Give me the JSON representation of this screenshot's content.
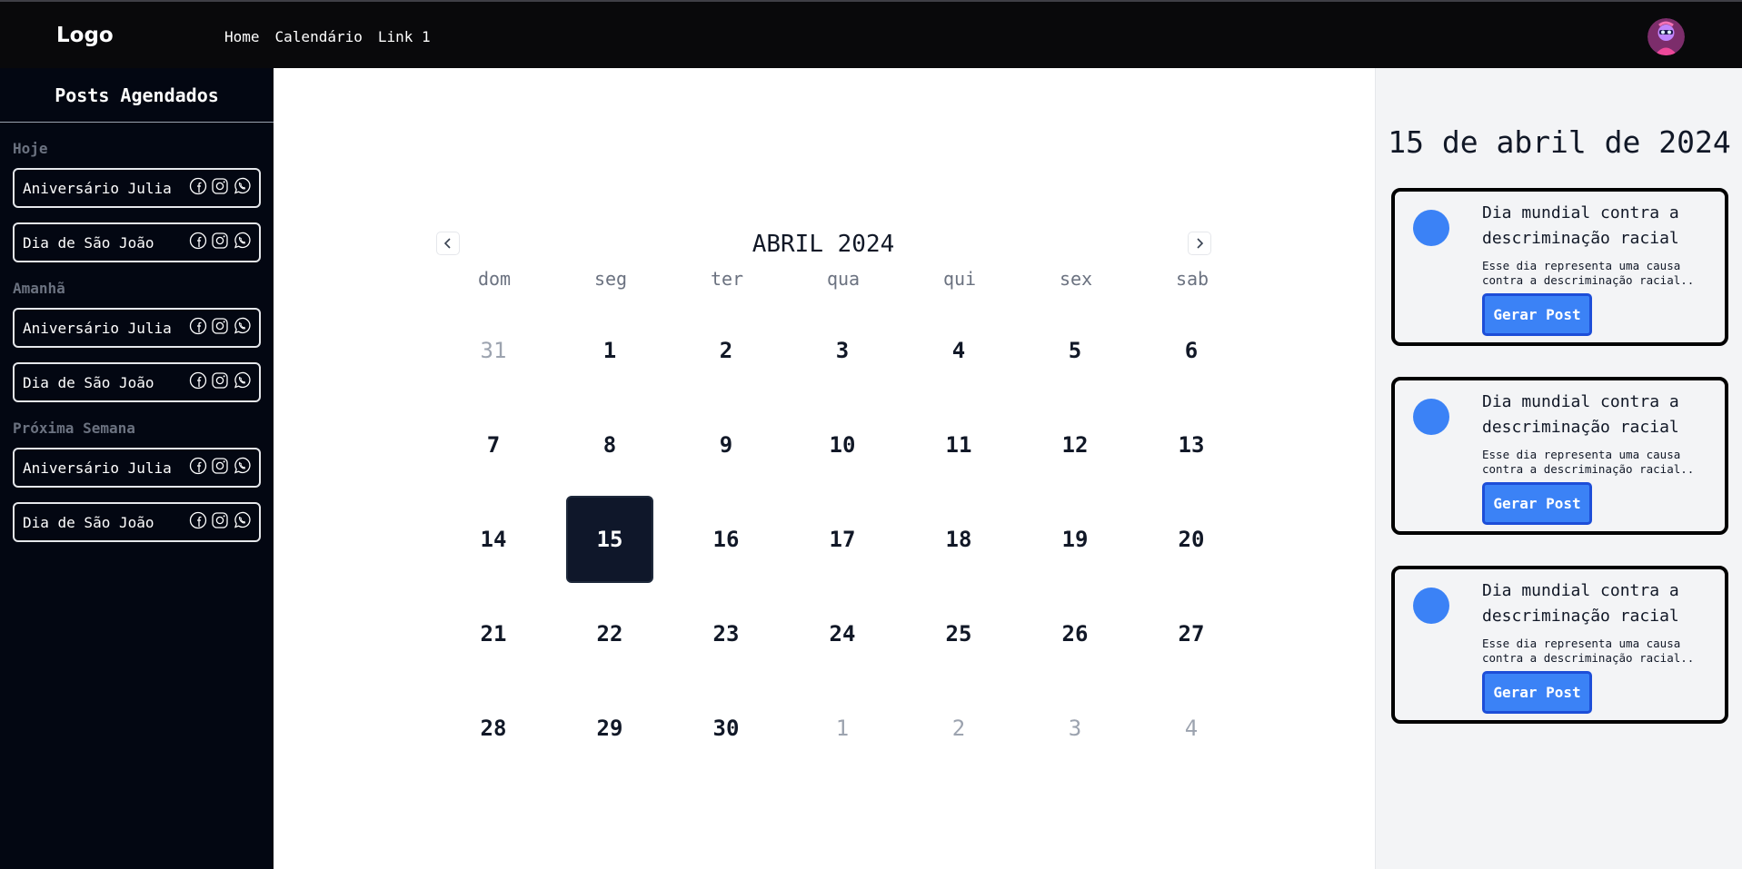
{
  "nav": {
    "logo": "Logo",
    "links": [
      "Home",
      "Calendário",
      "Link 1"
    ]
  },
  "sidebar": {
    "title": "Posts Agendados",
    "groups": [
      {
        "label": "Hoje",
        "items": [
          {
            "label": "Aniversário Julia",
            "icons": [
              "facebook-icon",
              "instagram-icon",
              "whatsapp-icon"
            ]
          },
          {
            "label": "Dia de São João",
            "icons": [
              "facebook-icon",
              "instagram-icon",
              "whatsapp-icon"
            ]
          }
        ]
      },
      {
        "label": "Amanhã",
        "items": [
          {
            "label": "Aniversário Julia",
            "icons": [
              "facebook-icon",
              "instagram-icon",
              "whatsapp-icon"
            ]
          },
          {
            "label": "Dia de São João",
            "icons": [
              "facebook-icon",
              "instagram-icon",
              "whatsapp-icon"
            ]
          }
        ]
      },
      {
        "label": "Próxima Semana",
        "items": [
          {
            "label": "Aniversário Julia",
            "icons": [
              "facebook-icon",
              "instagram-icon",
              "whatsapp-icon"
            ]
          },
          {
            "label": "Dia de São João",
            "icons": [
              "facebook-icon",
              "instagram-icon",
              "whatsapp-icon"
            ]
          }
        ]
      }
    ]
  },
  "calendar": {
    "title": "ABRIL 2024",
    "weekdays": [
      "dom",
      "seg",
      "ter",
      "qua",
      "qui",
      "sex",
      "sab"
    ],
    "selected_day": "15",
    "days": [
      {
        "d": "31",
        "muted": true
      },
      {
        "d": "1"
      },
      {
        "d": "2"
      },
      {
        "d": "3"
      },
      {
        "d": "4"
      },
      {
        "d": "5"
      },
      {
        "d": "6"
      },
      {
        "d": "7"
      },
      {
        "d": "8"
      },
      {
        "d": "9"
      },
      {
        "d": "10"
      },
      {
        "d": "11"
      },
      {
        "d": "12"
      },
      {
        "d": "13"
      },
      {
        "d": "14"
      },
      {
        "d": "15"
      },
      {
        "d": "16"
      },
      {
        "d": "17"
      },
      {
        "d": "18"
      },
      {
        "d": "19"
      },
      {
        "d": "20"
      },
      {
        "d": "21"
      },
      {
        "d": "22"
      },
      {
        "d": "23"
      },
      {
        "d": "24"
      },
      {
        "d": "25"
      },
      {
        "d": "26"
      },
      {
        "d": "27"
      },
      {
        "d": "28"
      },
      {
        "d": "29"
      },
      {
        "d": "30"
      },
      {
        "d": "1",
        "muted": true
      },
      {
        "d": "2",
        "muted": true
      },
      {
        "d": "3",
        "muted": true
      },
      {
        "d": "4",
        "muted": true
      }
    ]
  },
  "panel": {
    "date": "15 de abril de 2024",
    "cards": [
      {
        "title": "Dia mundial contra a descriminação racial",
        "desc": "Esse dia representa uma causa contra a descriminação racial..",
        "button": "Gerar Post"
      },
      {
        "title": "Dia mundial contra a descriminação racial",
        "desc": "Esse dia representa uma causa contra a descriminação racial..",
        "button": "Gerar Post"
      },
      {
        "title": "Dia mundial contra a descriminação racial",
        "desc": "Esse dia representa uma causa contra a descriminação racial..",
        "button": "Gerar Post"
      }
    ]
  },
  "colors": {
    "accent": "#3b82f6",
    "sidebar_bg": "#030712",
    "topbar_bg": "#09090b",
    "selected_day_bg": "#0f172a"
  }
}
